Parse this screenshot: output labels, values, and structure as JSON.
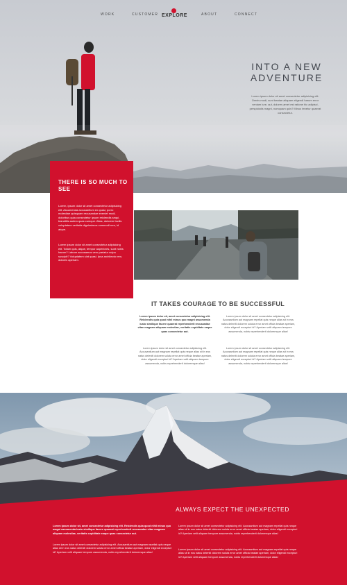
{
  "nav": {
    "items": [
      "WORK",
      "CUSTOMER",
      "ABOUT",
      "CONNECT"
    ],
    "brand": "EXPLORE"
  },
  "hero": {
    "title": "INTO A NEW ADVENTURE",
    "text": "Lorem ipsum dolor sit amet consectetur adipisicing elit. Omnis modi, sunt beatae aliquam eligendi harum error veniam iure, aut, dolores amet est ratione hic adipisci, perspiciatis magni, numquam quis? Minus tenetur quaerat consectetur."
  },
  "red_block": {
    "title": "THERE IS SO MUCH TO SEE",
    "para1": "Lorem, ipsum dolor sit amet consectetur adipisicing elit. Assumenda accusantium ex quasi, porro molestiae quisquam recusandae eveniet modi, doloribus quia consectetur ipsum reiciendis sequi, blanditiis autem quas cumque. Alias, dolorem facilis voluptatem veritatis dignissimos commodi rem, id atque.",
    "para2": "Lorem ipsum dolor sit amet consectetur adipisicing elit. Totam quis, atque, tempor asperiores, sunt nobis harum? Labore accusamus vero pariatur culpa suscipit? Voluptatem sint quasi. Ipsa architecto rem, dolores aperiam."
  },
  "courage": {
    "title": "IT TAKES COURAGE TO BE SUCCESSFUL",
    "col1_bold": "Lorem ipsum dolor sit, amet consectetur adipisicing elit. Reiciendis quia quod nihil minus quo magni assumenda iusto similique facere quaerat reprehenderit recusandae vitae magnam aliquam molestiae, veritatis cupiditate eaque quas consectetur aut.",
    "col1_para2": "Lorem ipsum dolor sit amet consectetur adipisicing elit. Accusantium aut magnam repellat quis neque alias sit in eos natus deleniti dolorem soluta error amet officia beatae aperiam, dolor eligendi excepturi id? Aperiam velit aliquam tempore assumenda, nobis reprehenderit doloremque alias!",
    "col2_para1": "Lorem ipsum dolor sit amet consectetur adipisicing elit. Accusantium aut magnam repellat quis neque alias sit in eos natus deleniti dolorem soluta error amet officia beatae aperiam, dolor eligendi excepturi id? Aperiam velit aliquam tempore assumenda, nobis reprehenderit doloremque alias!",
    "col2_para2": "Lorem ipsum dolor sit amet consectetur adipisicing elit. Accusantium aut magnam repellat quis neque alias sit in eos natus deleniti dolorem soluta error amet officia beatae aperiam, dolor eligendi excepturi id? Aperiam velit aliquam tempore assumenda, nobis reprehenderit doloremque alias!"
  },
  "unexpected": {
    "title": "ALWAYS EXPECT THE UNEXPECTED",
    "left_bold": "Lorem ipsum dolor sit, amet consectetur adipisicing elit. Reiciendis quia quod nihil minus quo magni assumenda iusto similique facere quaerat reprehenderit recusandae vitae magnam aliquam molestiae, veritatis cupiditate eaque quas consectetur aut.",
    "left_para2": "Lorem ipsum dolor sit amet consectetur adipisicing elit. Accusantium aut magnam repellat quis neque alias sit in eos natus deleniti dolorem soluta error amet officia beatae aperiam, dolor eligendi excepturi id? Aperiam velit aliquam tempore assumenda, nobis reprehenderit doloremque alias!",
    "right_para1": "Lorem ipsum dolor sit amet consectetur adipisicing elit. Accusantium aut magnam repellat quis neque alias sit in eos natus deleniti dolorem soluta error amet officia beatae aperiam, dolor eligendi excepturi id? Aperiam velit aliquam tempore assumenda, nobis reprehenderit doloremque alias!",
    "right_para2": "Lorem ipsum dolor sit amet consectetur adipisicing elit. Accusantium aut magnam repellat quis neque alias sit in eos natus deleniti dolorem soluta error amet officia beatae aperiam, dolor eligendi excepturi id? Aperiam velit aliquam tempore assumenda, nobis reprehenderit doloremque alias!"
  },
  "colors": {
    "accent": "#d1112d",
    "heading": "#41454d"
  },
  "icons": {
    "logo": "compass-badge-icon"
  }
}
